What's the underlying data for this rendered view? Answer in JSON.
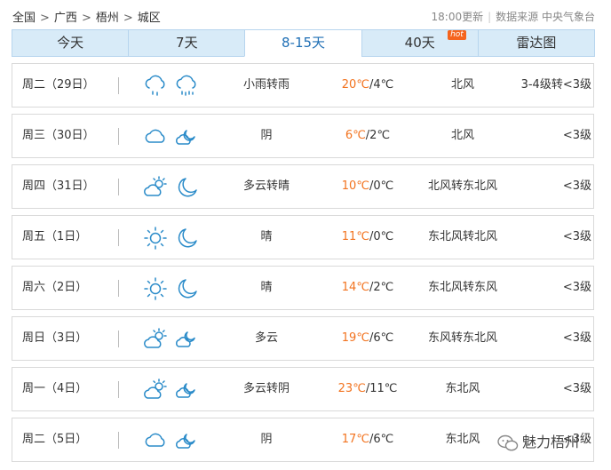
{
  "breadcrumb": {
    "items": [
      "全国",
      "广西",
      "梧州",
      "城区"
    ],
    "separator": ">"
  },
  "meta": {
    "update": "18:00更新",
    "source": "数据来源 中央气象台"
  },
  "tabs": [
    {
      "label": "今天"
    },
    {
      "label": "7天"
    },
    {
      "label": "8-15天",
      "active": true
    },
    {
      "label": "40天",
      "badge": "hot"
    },
    {
      "label": "雷达图"
    }
  ],
  "colors": {
    "accent": "#2a8bc9",
    "high_temp": "#f2731f",
    "tab_bg": "#d8ebf8",
    "hot_badge": "#f5641e"
  },
  "days": [
    {
      "date": "周二（29日）",
      "day_icon": "cloud-rain-icon",
      "night_icon": "cloud-rain-heavy-icon",
      "desc": "小雨转雨",
      "high": "20℃",
      "low": "/4℃",
      "wind": "北风",
      "level": "3-4级转<3级"
    },
    {
      "date": "周三（30日）",
      "day_icon": "cloud-icon",
      "night_icon": "cloudy-night-icon",
      "desc": "阴",
      "high": "6℃",
      "low": "/2℃",
      "wind": "北风",
      "level": "<3级"
    },
    {
      "date": "周四（31日）",
      "day_icon": "partly-cloudy-day-icon",
      "night_icon": "moon-icon",
      "desc": "多云转晴",
      "high": "10℃",
      "low": "/0℃",
      "wind": "北风转东北风",
      "level": "<3级"
    },
    {
      "date": "周五（1日）",
      "day_icon": "sun-icon",
      "night_icon": "moon-icon",
      "desc": "晴",
      "high": "11℃",
      "low": "/0℃",
      "wind": "东北风转北风",
      "level": "<3级"
    },
    {
      "date": "周六（2日）",
      "day_icon": "sun-icon",
      "night_icon": "moon-icon",
      "desc": "晴",
      "high": "14℃",
      "low": "/2℃",
      "wind": "东北风转东风",
      "level": "<3级"
    },
    {
      "date": "周日（3日）",
      "day_icon": "partly-cloudy-day-icon",
      "night_icon": "partly-cloudy-night-icon",
      "desc": "多云",
      "high": "19℃",
      "low": "/6℃",
      "wind": "东风转东北风",
      "level": "<3级"
    },
    {
      "date": "周一（4日）",
      "day_icon": "partly-cloudy-day-icon",
      "night_icon": "cloudy-night-icon",
      "desc": "多云转阴",
      "high": "23℃",
      "low": "/11℃",
      "wind": "东北风",
      "level": "<3级"
    },
    {
      "date": "周二（5日）",
      "day_icon": "cloud-icon",
      "night_icon": "cloudy-night-icon",
      "desc": "阴",
      "high": "17℃",
      "low": "/6℃",
      "wind": "东北风",
      "level": "<3级"
    }
  ],
  "watermark": {
    "text": "魅力梧州",
    "icon": "wechat-icon"
  }
}
